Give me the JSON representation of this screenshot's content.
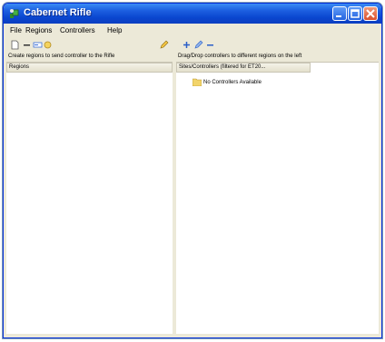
{
  "window": {
    "title": "Cabernet Rifle"
  },
  "menu": {
    "file": "File",
    "regions": "Regions",
    "controllers": "Controllers",
    "help": "Help"
  },
  "left_pane": {
    "hint": "Create regions to send controller to the Rifle",
    "column_header": "Regions"
  },
  "right_pane": {
    "hint": "Drag/Drop controllers to different regions on the left",
    "column_header": "Sites/Controllers (filtered for ET20...",
    "tree_items": [
      "No Controllers Available"
    ]
  },
  "colors": {
    "titlebar": "#0a46cf",
    "chrome": "#ece9d8",
    "pane_bg": "#ffffff",
    "folder": "#f2d46b"
  }
}
